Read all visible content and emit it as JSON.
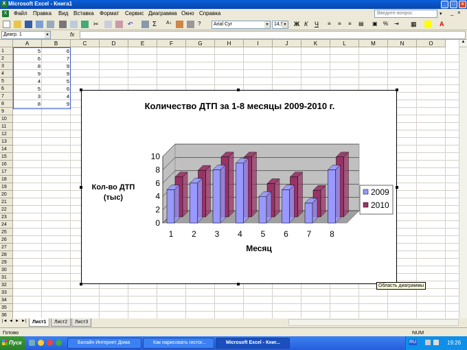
{
  "titlebar": {
    "title": "Microsoft Excel - Книга1"
  },
  "menu": [
    "Файл",
    "Правка",
    "Вид",
    "Вставка",
    "Формат",
    "Сервис",
    "Диаграмма",
    "Окно",
    "Справка"
  ],
  "help": {
    "placeholder": "Введите вопрос"
  },
  "toolbar": {
    "font": "Arial Cyr",
    "size": "14,5"
  },
  "formula": {
    "namebox": "Диагр. 1",
    "fx": "fx"
  },
  "columns": [
    "A",
    "B",
    "C",
    "D",
    "E",
    "F",
    "G",
    "H",
    "I",
    "J",
    "K",
    "L",
    "M",
    "N",
    "O"
  ],
  "rows": [
    "1",
    "2",
    "3",
    "4",
    "5",
    "6",
    "7",
    "8",
    "9",
    "10",
    "11",
    "12",
    "13",
    "14",
    "15",
    "16",
    "17",
    "18",
    "19",
    "20",
    "21",
    "22",
    "23",
    "24",
    "25",
    "26",
    "27",
    "28",
    "29",
    "30",
    "31",
    "32",
    "33",
    "34",
    "35",
    "36"
  ],
  "cells": {
    "A": [
      5,
      6,
      8,
      9,
      4,
      5,
      3,
      8
    ],
    "B": [
      6,
      7,
      9,
      9,
      5,
      6,
      4,
      9
    ]
  },
  "chart_data": {
    "type": "bar",
    "title": "Количество ДТП за 1-8 месяцы 2009-2010 г.",
    "xlabel": "Месяц",
    "ylabel": "Кол-во ДТП (тыс)",
    "categories": [
      "1",
      "2",
      "3",
      "4",
      "5",
      "6",
      "7",
      "8"
    ],
    "series": [
      {
        "name": "2009",
        "values": [
          5,
          6,
          8,
          9,
          4,
          5,
          3,
          8
        ],
        "color": "#9999ff"
      },
      {
        "name": "2010",
        "values": [
          6,
          7,
          9,
          9,
          5,
          6,
          4,
          9
        ],
        "color": "#993366"
      }
    ],
    "yticks": [
      "0",
      "2",
      "4",
      "6",
      "8",
      "10"
    ],
    "ylim": [
      0,
      10
    ],
    "legend": "right",
    "style": "3d-clustered-column"
  },
  "tooltip": "Область диаграммы",
  "sheets": [
    "Лист1",
    "Лист2",
    "Лист3"
  ],
  "status": {
    "left": "Готово",
    "num": "NUM"
  },
  "taskbar": {
    "start": "Пуск",
    "tasks": [
      "Билайн Интернет Дома",
      "Как нарисовать гистог...",
      "Microsoft Excel - Книг..."
    ],
    "lang": "RU",
    "time": "19:26"
  }
}
